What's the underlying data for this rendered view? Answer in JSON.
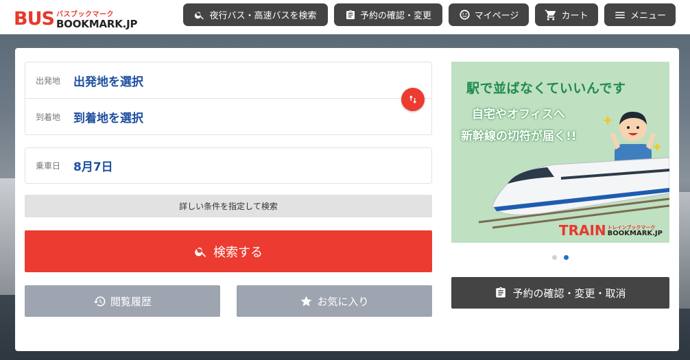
{
  "header": {
    "logo_main": "BUS",
    "logo_kana": "バスブックマーク",
    "logo_domain": "BOOKMARK.JP",
    "nav": {
      "search": "夜行バス・高速バスを検索",
      "reservation": "予約の確認・変更",
      "mypage": "マイページ",
      "cart": "カート",
      "menu": "メニュー"
    }
  },
  "form": {
    "departure_label": "出発地",
    "departure_value": "出発地を選択",
    "arrival_label": "到着地",
    "arrival_value": "到着地を選択",
    "date_label": "乗車日",
    "date_value": "8月7日",
    "detail_search": "詳しい条件を指定して検索",
    "search_button": "検索する",
    "history_button": "閲覧履歴",
    "favorite_button": "お気に入り"
  },
  "banner": {
    "headline": "駅で並ばなくていいんです",
    "line2": "自宅やオフィスへ",
    "line3": "新幹線の切符が届く!!",
    "brand_main": "TRAIN",
    "brand_kana": "トレインブックマーク",
    "brand_domain": "BOOKMARK.JP",
    "carousel_total": 2,
    "carousel_active": 2
  },
  "side": {
    "confirm_button": "予約の確認・変更・取消"
  },
  "colors": {
    "brand_red": "#ec3b30",
    "nav_dark": "#444444",
    "value_blue": "#1e4fa0",
    "sub_button_gray": "#9ea4b0",
    "banner_green": "#bfe0c1"
  }
}
